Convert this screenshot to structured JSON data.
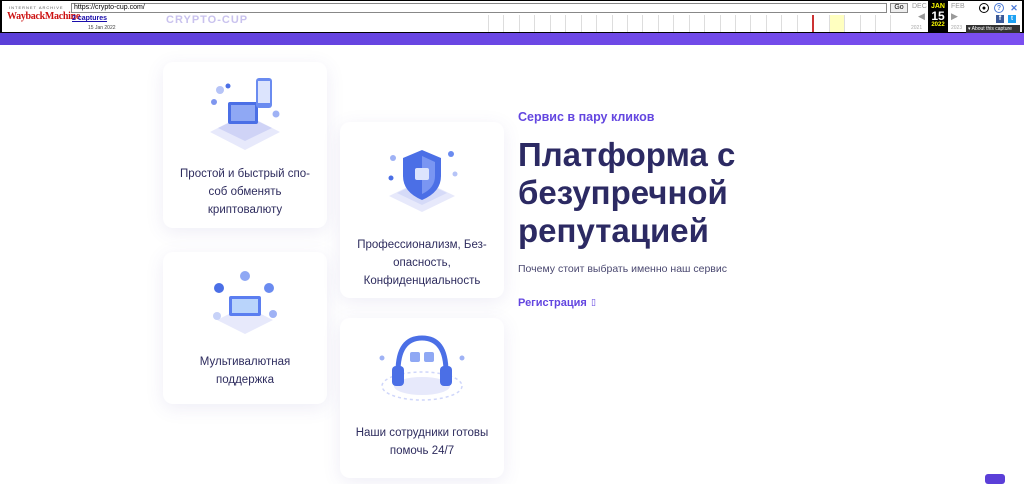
{
  "wayback": {
    "logo_top": "INTERNET ARCHIVE",
    "logo_main": "WaybackMachine",
    "url": "https://crypto-cup.com/",
    "go_label": "Go",
    "captures": "2 captures",
    "capture_date": "15 Jan 2022",
    "prev_month": "DEC",
    "cur_month": "JAN",
    "cur_day": "15",
    "cur_year": "2022",
    "next_month": "FEB",
    "prev_year": "2021",
    "next_year": "2023",
    "about": "About this capture",
    "icons": [
      "user-icon",
      "help-icon",
      "close-icon",
      "facebook-icon",
      "twitter-icon"
    ]
  },
  "site": {
    "logo": "CRYPTO-CUP",
    "accent_color": "#6346e0",
    "heading_color": "#2c2a63"
  },
  "cards": [
    {
      "text_lines": [
        "Простой и быстрый спо-",
        "соб обменять",
        "криптовалюту"
      ],
      "icon": "laptop-phone-icon"
    },
    {
      "text_lines": [
        "Мультивалютная",
        "поддержка"
      ],
      "icon": "multicurrency-icon"
    },
    {
      "text_lines": [
        "Профессионализм, Без-",
        "опасность,",
        "Конфиденциальность"
      ],
      "icon": "shield-icon"
    },
    {
      "text_lines": [
        "Наши сотрудники готовы",
        "помочь 24/7"
      ],
      "icon": "headphones-icon"
    }
  ],
  "hero": {
    "eyebrow": "Сервис в пару кликов",
    "title_lines": [
      "Платформа с",
      "безупречной",
      "репутацией"
    ],
    "subtitle": "Почему стоит выбрать именно наш сервис",
    "register_label": "Регистрация",
    "register_icon": "arrow-icon"
  }
}
